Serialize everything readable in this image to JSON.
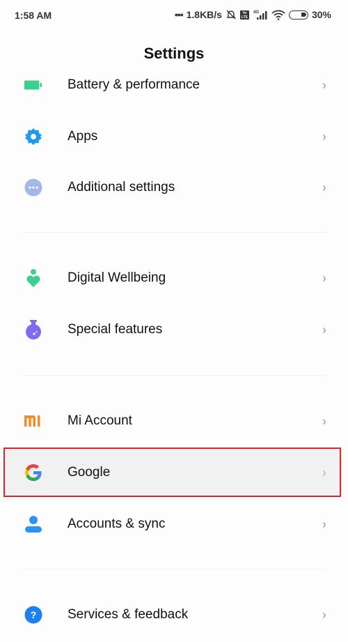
{
  "status_bar": {
    "time": "1:58 AM",
    "dots": "•••",
    "network_speed": "1.8KB/s",
    "icons": [
      "mute-bell-icon",
      "volte-icon",
      "signal-4g-icon",
      "wifi-icon",
      "battery-icon"
    ],
    "volte_text": "Vo LTE",
    "network_type": "4G",
    "battery_percent": "30%"
  },
  "header": {
    "title": "Settings"
  },
  "colors": {
    "battery": "#3ecf8e",
    "apps": "#1e9bf0",
    "additional": "#a3b8e8",
    "wellbeing": "#3ecf8e",
    "special": "#7b6cf0",
    "mi": "#f08c2a",
    "accounts": "#2b94f5",
    "services": "#1e7ff0",
    "highlight_border": "#d7262f"
  },
  "settings": {
    "items": [
      {
        "label": "Battery & performance",
        "icon": "battery-icon"
      },
      {
        "label": "Apps",
        "icon": "gear-icon"
      },
      {
        "label": "Additional settings",
        "icon": "more-dots-icon"
      },
      {
        "label": "Digital Wellbeing",
        "icon": "wellbeing-heart-icon"
      },
      {
        "label": "Special features",
        "icon": "flask-icon"
      },
      {
        "label": "Mi Account",
        "icon": "mi-logo-icon"
      },
      {
        "label": "Google",
        "icon": "google-g-icon",
        "highlighted": true
      },
      {
        "label": "Accounts & sync",
        "icon": "person-icon"
      },
      {
        "label": "Services & feedback",
        "icon": "question-icon"
      }
    ],
    "chevron": "›"
  }
}
